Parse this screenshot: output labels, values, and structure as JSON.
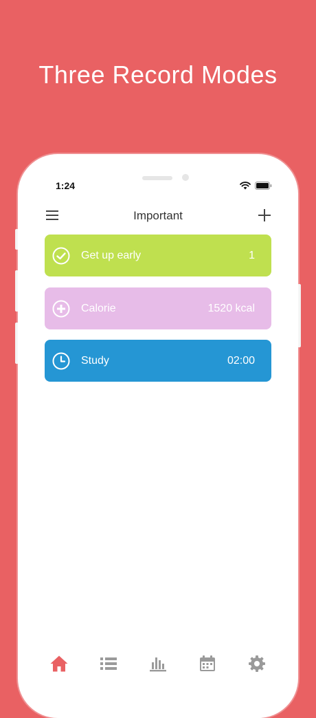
{
  "headline": "Three Record Modes",
  "status_bar": {
    "time": "1:24"
  },
  "nav": {
    "title": "Important"
  },
  "records": [
    {
      "label": "Get up early",
      "value": "1",
      "color": "#BFE04F",
      "icon": "check-circle-icon"
    },
    {
      "label": "Calorie",
      "value": "1520 kcal",
      "color": "#E7BCE8",
      "icon": "plus-circle-icon"
    },
    {
      "label": "Study",
      "value": "02:00",
      "color": "#2596D4",
      "icon": "clock-icon"
    }
  ],
  "tabs": [
    {
      "name": "home",
      "icon": "home-icon",
      "active": true
    },
    {
      "name": "list",
      "icon": "list-icon",
      "active": false
    },
    {
      "name": "stats",
      "icon": "bar-chart-icon",
      "active": false
    },
    {
      "name": "calendar",
      "icon": "calendar-icon",
      "active": false
    },
    {
      "name": "settings",
      "icon": "gear-icon",
      "active": false
    }
  ],
  "colors": {
    "background": "#E96163",
    "tab_active": "#E96163",
    "tab_inactive": "#9A9A9A"
  }
}
